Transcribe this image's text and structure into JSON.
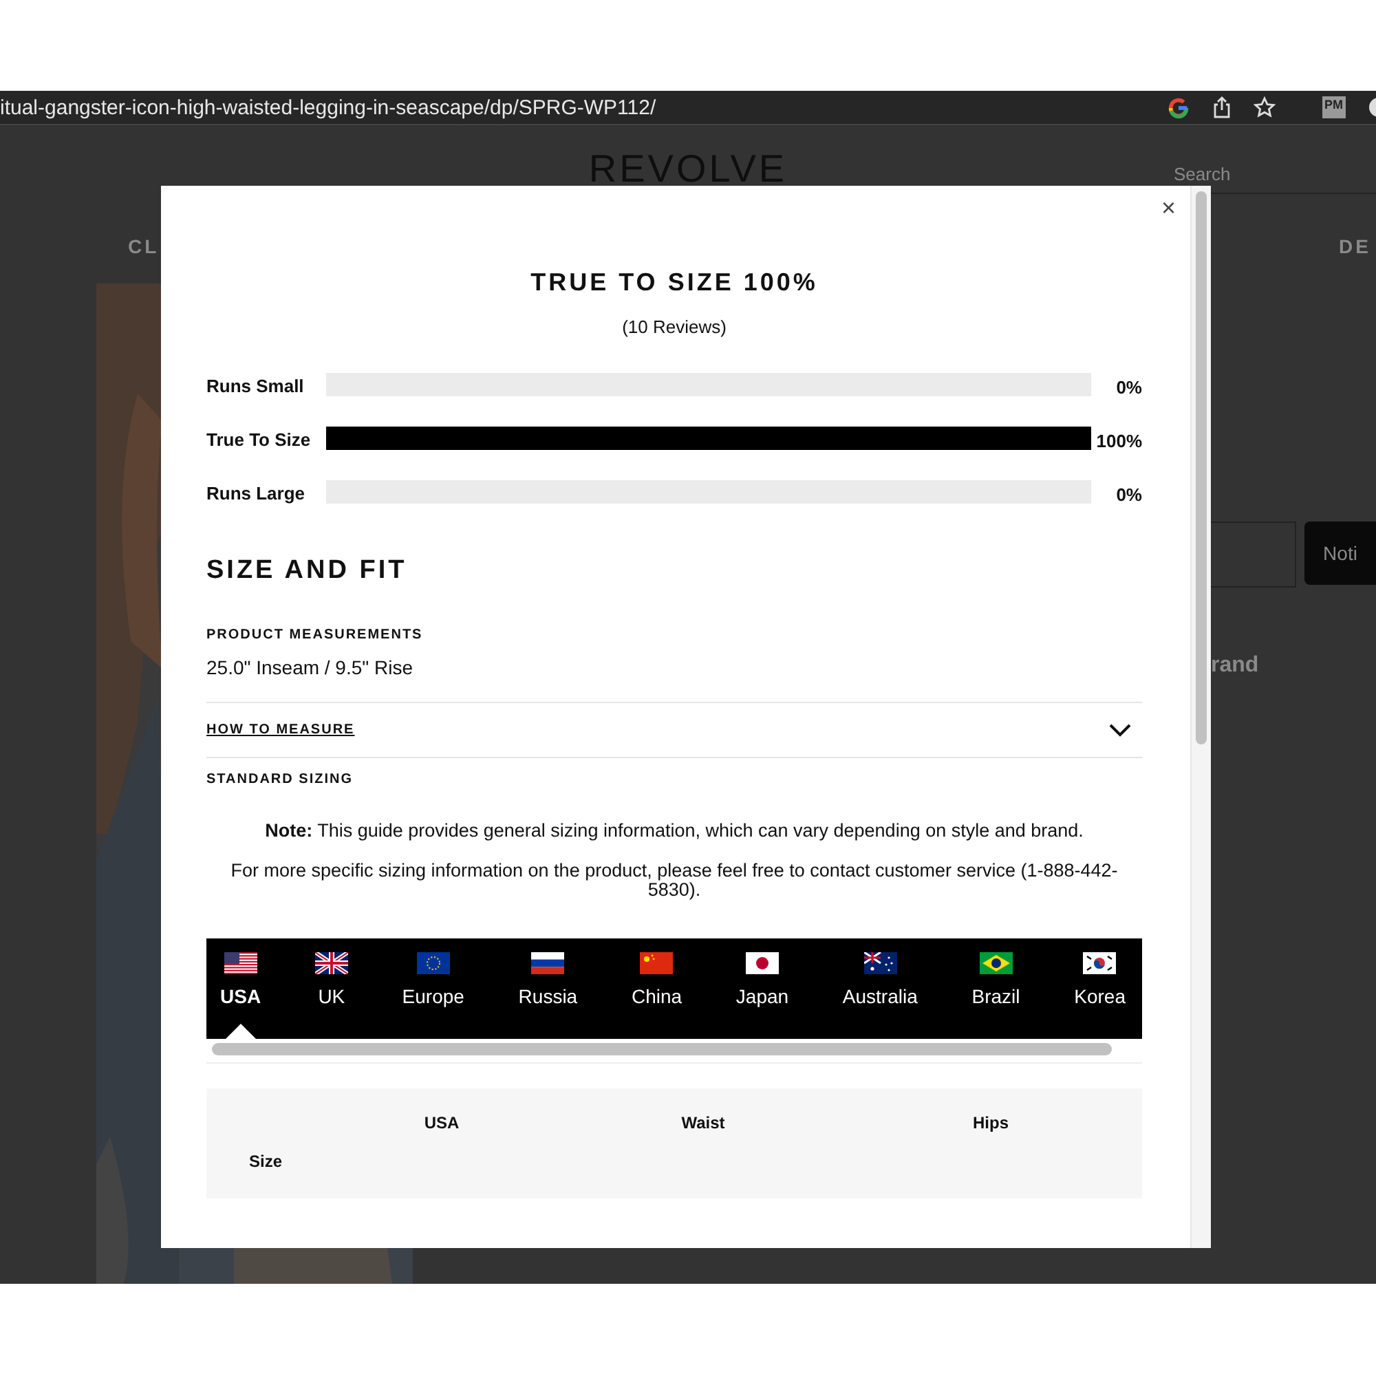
{
  "browser": {
    "url": "itual-gangster-icon-high-waisted-legging-in-seascape/dp/SPRG-WP112/",
    "extension_label": "PM"
  },
  "page": {
    "logo": "REVOLVE",
    "search_placeholder": "Search",
    "nav_left": "CL",
    "nav_right": "DE",
    "notify_button": "Noti",
    "brand_fragment": "rand"
  },
  "modal": {
    "close": "×",
    "title": "TRUE TO SIZE 100%",
    "reviews": "(10 Reviews)",
    "fit_rows": [
      {
        "label": "Runs Small",
        "level": 0,
        "reading": "0%"
      },
      {
        "label": "True To Size",
        "level": 1,
        "reading": "100%"
      },
      {
        "label": "Runs Large",
        "level": 0,
        "reading": "0%"
      }
    ],
    "section_title": "SIZE AND FIT",
    "measurements_heading": "PRODUCT MEASUREMENTS",
    "measurements": "25.0\" Inseam / 9.5\" Rise",
    "how_to_measure": {
      "label": "HOW TO MEASURE",
      "expanded": false
    },
    "standard_sizing_heading": "STANDARD SIZING",
    "note": "**Note:** This guide provides general sizing information, which can vary depending on style and brand.",
    "contact": "For more specific sizing information on the product, please feel free to contact customer service (1-888-442-5830).",
    "countries": [
      {
        "label": "USA",
        "selected": true
      },
      {
        "label": "UK",
        "selected": false
      },
      {
        "label": "Europe",
        "selected": false
      },
      {
        "label": "Russia",
        "selected": false
      },
      {
        "label": "China",
        "selected": false
      },
      {
        "label": "Japan",
        "selected": false
      },
      {
        "label": "Australia",
        "selected": false
      },
      {
        "label": "Brazil",
        "selected": false
      },
      {
        "label": "Korea",
        "selected": false
      }
    ],
    "table": {
      "columns": [
        "USA",
        "Waist",
        "Hips"
      ],
      "row_header": "Size"
    }
  }
}
